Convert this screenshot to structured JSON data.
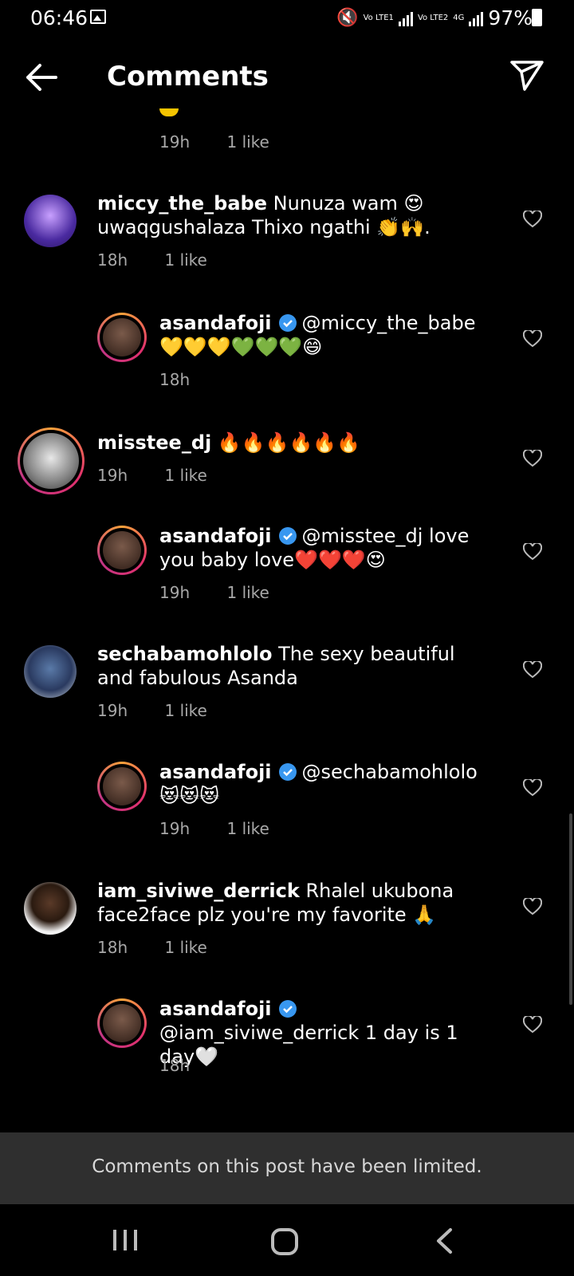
{
  "status": {
    "time": "06:46",
    "signal1": "Vo LTE1",
    "signal2": "Vo LTE2",
    "net": "4G",
    "battery": "97%"
  },
  "header": {
    "title": "Comments"
  },
  "top_meta": {
    "time": "19h",
    "likes": "1 like"
  },
  "comments": [
    {
      "user": "miccy_the_babe",
      "text": "Nunuza wam 😍 uwaqgushalaza Thixo ngathi 👏🙌.",
      "time": "18h",
      "likes": "1 like"
    },
    {
      "user": "asandafoji",
      "text": "@miccy_the_babe 💛💛💛💚💚💚😄",
      "time": "18h",
      "likes": ""
    },
    {
      "user": "misstee_dj",
      "text": "🔥🔥🔥🔥🔥🔥",
      "time": "19h",
      "likes": "1 like"
    },
    {
      "user": "asandafoji",
      "text": "@misstee_dj love you baby love❤️❤️❤️😍",
      "time": "19h",
      "likes": "1 like"
    },
    {
      "user": "sechabamohlolo",
      "text": "The sexy beautiful and fabulous Asanda",
      "time": "19h",
      "likes": "1 like"
    },
    {
      "user": "asandafoji",
      "text": "@sechabamohlolo 😻😻😻",
      "time": "19h",
      "likes": "1 like"
    },
    {
      "user": "iam_siviwe_derrick",
      "text": "Rhalel ukubona face2face plz you're my favorite 🙏",
      "time": "18h",
      "likes": "1 like"
    },
    {
      "user": "asandafoji",
      "text": "@iam_siviwe_derrick 1 day is 1 day🤍",
      "time": "18h",
      "likes": ""
    }
  ],
  "banner": {
    "text": "Comments on this post have been limited."
  },
  "colors": {
    "background": "#000000",
    "meta": "#a8a8a8",
    "verified": "#3897f0",
    "banner": "#2f2f2f"
  }
}
